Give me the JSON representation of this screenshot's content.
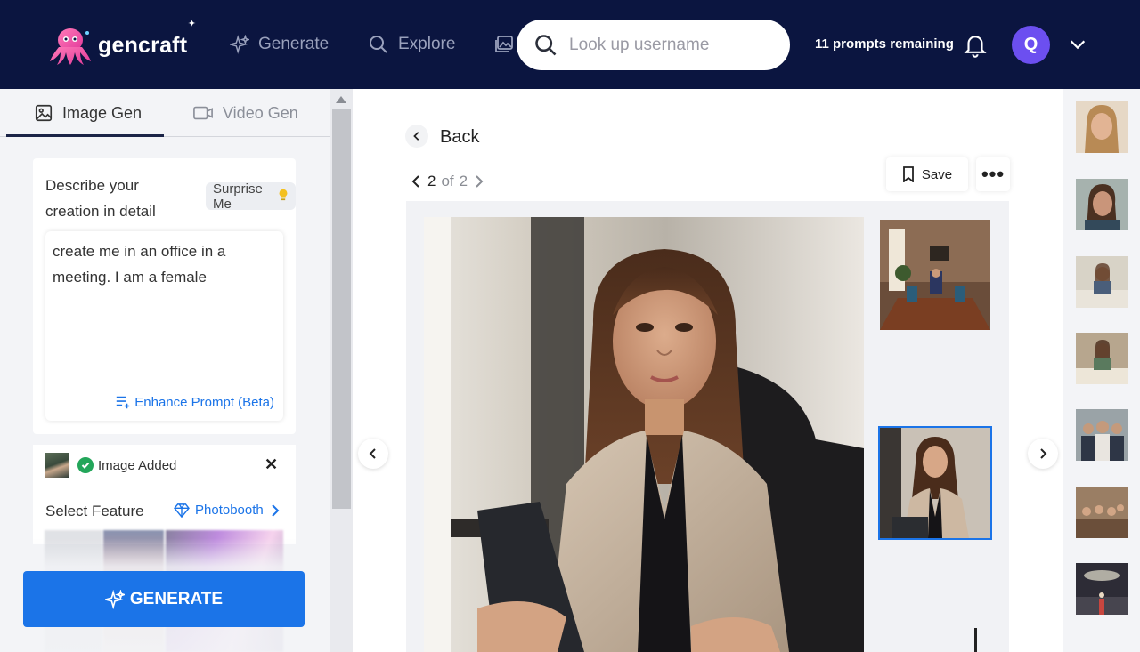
{
  "header": {
    "brand": "gencraft",
    "nav": [
      {
        "label": "Generate",
        "icon": "sparkle-icon"
      },
      {
        "label": "Explore",
        "icon": "search-icon"
      },
      {
        "label": "",
        "icon": "gallery-icon"
      }
    ],
    "search_placeholder": "Look up username",
    "prompts_remaining": "11 prompts remaining",
    "avatar_initial": "Q"
  },
  "left_panel": {
    "tabs": [
      {
        "label": "Image Gen",
        "active": true
      },
      {
        "label": "Video Gen",
        "active": false
      }
    ],
    "prompt_label": "Describe your creation in detail",
    "surprise_label": "Surprise Me",
    "prompt_value": "create me in an office in a meeting. I am a female",
    "enhance_label": "Enhance Prompt (Beta)",
    "image_added_label": "Image Added",
    "close_glyph": "✕",
    "select_feature_label": "Select Feature",
    "feature_value": "Photobooth",
    "generate_label": "GENERATE"
  },
  "main": {
    "back_label": "Back",
    "pager": {
      "current": "2",
      "of": "of",
      "total": "2"
    },
    "save_label": "Save",
    "more_glyph": "•••"
  },
  "colors": {
    "header_bg": "#0b1540",
    "accent": "#1b74e8",
    "avatar": "#6c4ff0",
    "success": "#23a65a"
  }
}
